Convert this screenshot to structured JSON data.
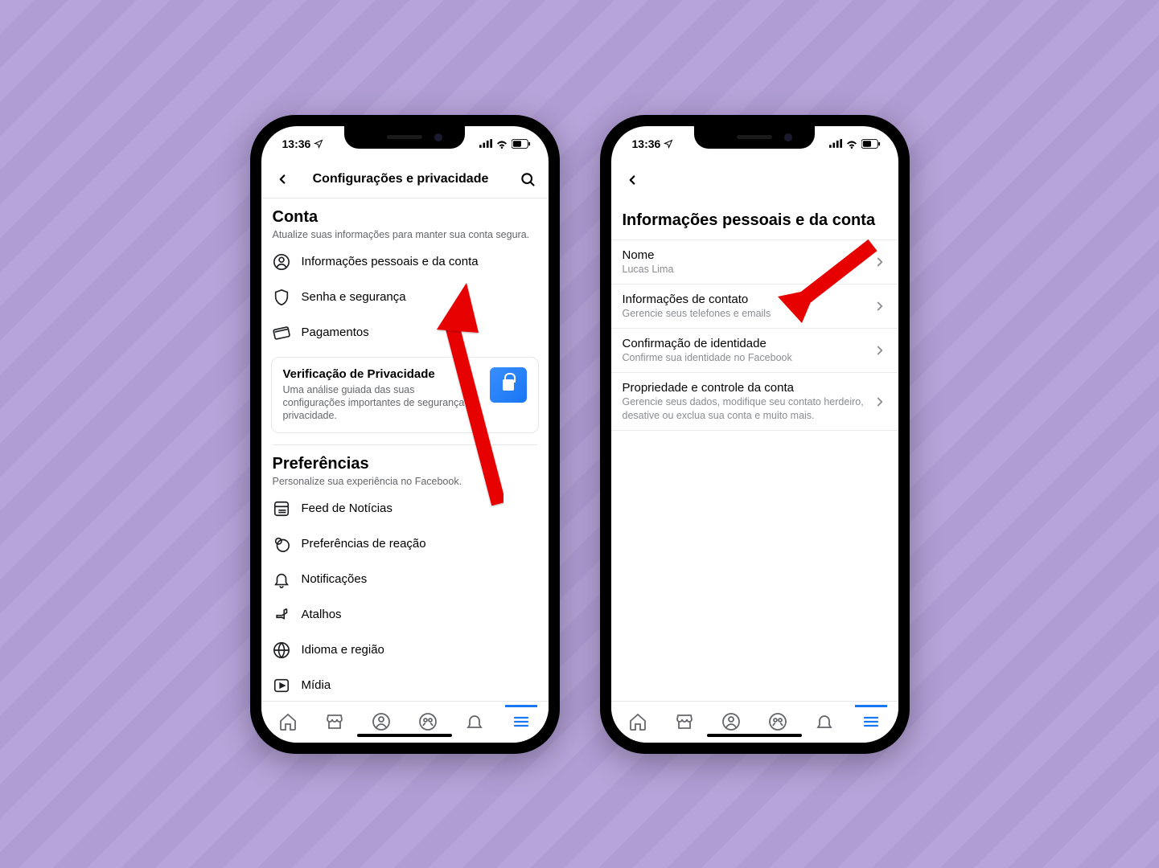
{
  "status": {
    "time": "13:36"
  },
  "phone1": {
    "title": "Configurações e privacidade",
    "sections": {
      "conta": {
        "heading": "Conta",
        "sub": "Atualize suas informações para manter sua conta segura.",
        "items": [
          {
            "label": "Informações pessoais e da conta"
          },
          {
            "label": "Senha e segurança"
          },
          {
            "label": "Pagamentos"
          }
        ]
      },
      "privacy_card": {
        "title": "Verificação de Privacidade",
        "desc": "Uma análise guiada das suas configurações importantes de segurança e privacidade."
      },
      "preferencias": {
        "heading": "Preferências",
        "sub": "Personalize sua experiência no Facebook.",
        "items": [
          {
            "label": "Feed de Notícias"
          },
          {
            "label": "Preferências de reação"
          },
          {
            "label": "Notificações"
          },
          {
            "label": "Atalhos"
          },
          {
            "label": "Idioma e região"
          },
          {
            "label": "Mídia"
          }
        ]
      }
    }
  },
  "phone2": {
    "title": "Informações pessoais e da conta",
    "rows": [
      {
        "title": "Nome",
        "sub": "Lucas Lima"
      },
      {
        "title": "Informações de contato",
        "sub": "Gerencie seus telefones e emails"
      },
      {
        "title": "Confirmação de identidade",
        "sub": "Confirme sua identidade no Facebook"
      },
      {
        "title": "Propriedade e controle da conta",
        "sub": "Gerencie seus dados, modifique seu contato herdeiro, desative ou exclua sua conta e muito mais."
      }
    ]
  }
}
